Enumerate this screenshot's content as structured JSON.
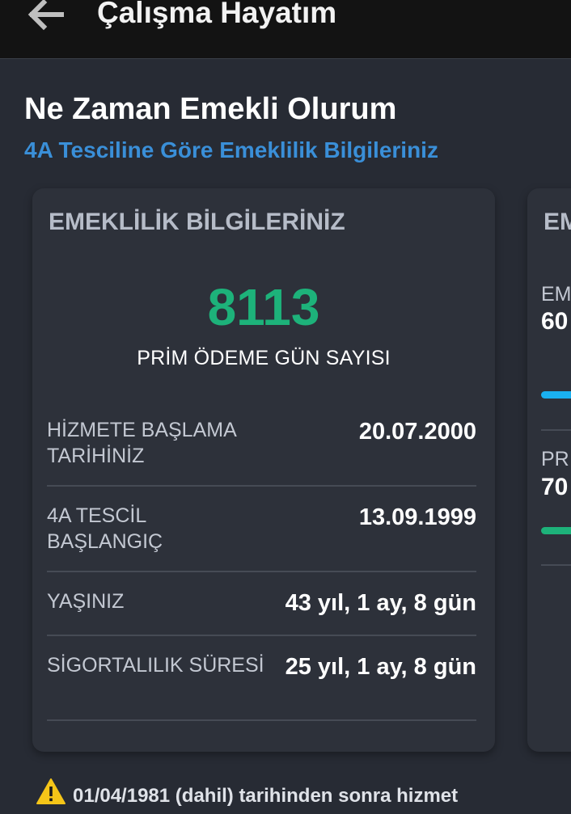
{
  "app_bar": {
    "title": "Çalışma Hayatım"
  },
  "header": {
    "title": "Ne Zaman Emekli Olurum",
    "subtitle": "4A Tesciline Göre Emeklilik Bilgileriniz"
  },
  "main_card": {
    "title": "EMEKLİLİK BİLGİLERİNİZ",
    "premium_days": "8113",
    "premium_days_label": "PRİM ÖDEME GÜN SAYISI",
    "rows": [
      {
        "label": "HİZMETE BAŞLAMA TARİHİNİZ",
        "value": "20.07.2000"
      },
      {
        "label": "4A TESCİL BAŞLANGIÇ",
        "value": "13.09.1999"
      },
      {
        "label": "YAŞINIZ",
        "value": "43 yıl, 1 ay, 8 gün"
      },
      {
        "label": "SİGORTALILIK SÜRESİ",
        "value": "25 yıl, 1 ay, 8 gün"
      }
    ]
  },
  "side_card": {
    "title": "EM",
    "items": [
      {
        "label": "EM",
        "value": "60",
        "bar_color": "#1ab0f0"
      },
      {
        "label": "PR",
        "value": "70",
        "bar_color": "#1db27a"
      }
    ]
  },
  "notice": {
    "text": "01/04/1981 (dahil) tarihinden sonra hizmet"
  },
  "colors": {
    "accent_blue": "#3a8fd8",
    "accent_green": "#1db27a",
    "warning": "#f5c518"
  }
}
